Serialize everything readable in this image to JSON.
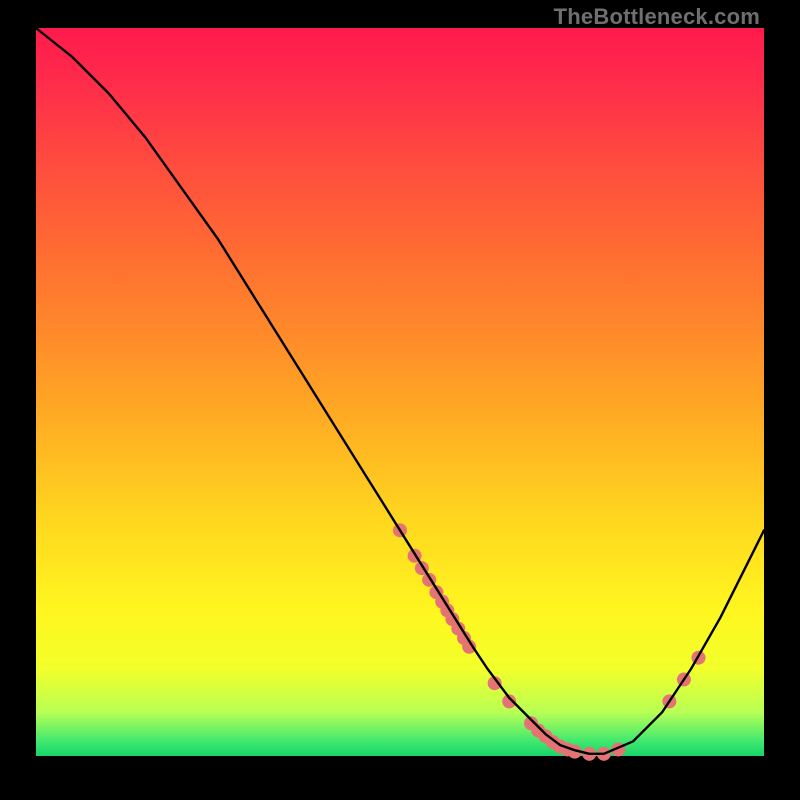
{
  "watermark": "TheBottleneck.com",
  "chart_data": {
    "type": "line",
    "title": "",
    "xlabel": "",
    "ylabel": "",
    "xlim": [
      0,
      100
    ],
    "ylim": [
      0,
      100
    ],
    "grid": false,
    "legend": false,
    "series": [
      {
        "name": "curve",
        "color": "#000000",
        "x": [
          0,
          5,
          10,
          15,
          20,
          25,
          30,
          35,
          40,
          45,
          50,
          55,
          60,
          62,
          65,
          68,
          70,
          72,
          74,
          76,
          78,
          82,
          86,
          90,
          94,
          100
        ],
        "y": [
          100,
          96,
          91,
          85,
          78,
          71,
          63,
          55,
          47,
          39,
          31,
          23,
          15,
          12,
          8,
          5,
          3,
          1.5,
          0.8,
          0.3,
          0.3,
          2,
          6,
          12,
          19,
          31
        ]
      }
    ],
    "markers": {
      "name": "dots",
      "color": "#e57373",
      "radius": 7,
      "points": [
        {
          "x": 50,
          "y": 31
        },
        {
          "x": 52,
          "y": 27.5
        },
        {
          "x": 53,
          "y": 25.8
        },
        {
          "x": 54,
          "y": 24.2
        },
        {
          "x": 55,
          "y": 22.5
        },
        {
          "x": 55.8,
          "y": 21.2
        },
        {
          "x": 56.5,
          "y": 20
        },
        {
          "x": 57.2,
          "y": 18.8
        },
        {
          "x": 58,
          "y": 17.5
        },
        {
          "x": 58.8,
          "y": 16.2
        },
        {
          "x": 59.5,
          "y": 15
        },
        {
          "x": 63,
          "y": 10
        },
        {
          "x": 65,
          "y": 7.5
        },
        {
          "x": 68,
          "y": 4.5
        },
        {
          "x": 69,
          "y": 3.5
        },
        {
          "x": 70,
          "y": 2.7
        },
        {
          "x": 71,
          "y": 1.9
        },
        {
          "x": 72,
          "y": 1.3
        },
        {
          "x": 73,
          "y": 0.9
        },
        {
          "x": 74,
          "y": 0.6
        },
        {
          "x": 76,
          "y": 0.3
        },
        {
          "x": 78,
          "y": 0.3
        },
        {
          "x": 80,
          "y": 0.9
        },
        {
          "x": 87,
          "y": 7.5
        },
        {
          "x": 89,
          "y": 10.5
        },
        {
          "x": 91,
          "y": 13.5
        }
      ]
    }
  }
}
